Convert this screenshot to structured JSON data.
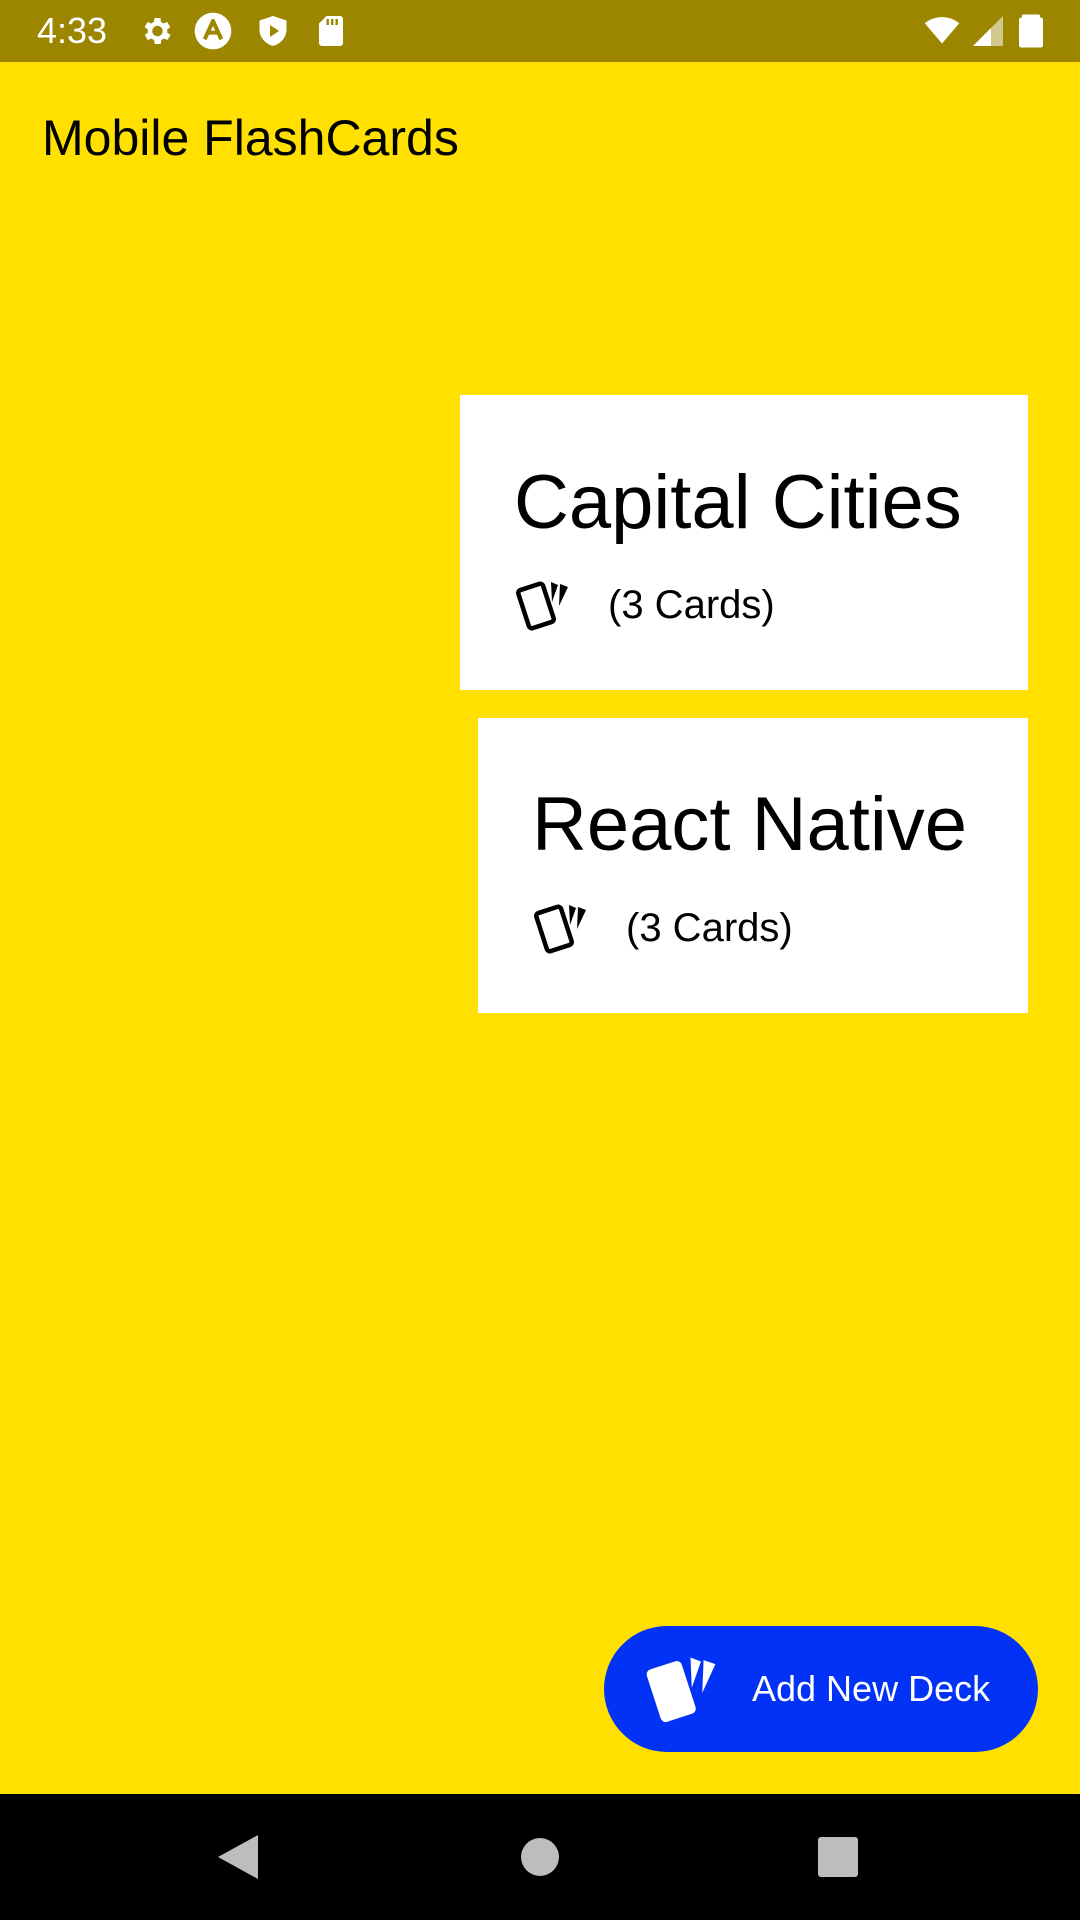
{
  "status_bar": {
    "time": "4:33",
    "left_icons": [
      "settings-icon",
      "app-a-icon",
      "shield-play-icon",
      "sd-card-icon"
    ],
    "right_icons": [
      "wifi-icon",
      "signal-icon",
      "battery-icon"
    ]
  },
  "app": {
    "title": "Mobile FlashCards"
  },
  "decks": [
    {
      "title": "Capital Cities",
      "count_label": "(3 Cards)",
      "icon": "cards-icon"
    },
    {
      "title": "React Native",
      "count_label": "(3 Cards)",
      "icon": "cards-icon"
    }
  ],
  "fab": {
    "label": "Add New Deck",
    "icon": "cards-icon"
  },
  "nav_bar": {
    "buttons": [
      "back",
      "home",
      "recents"
    ]
  },
  "colors": {
    "background": "#FFE000",
    "status_bar": "#9C8600",
    "card": "#FFFFFF",
    "fab": "#0232F5",
    "nav_bar": "#000000"
  }
}
